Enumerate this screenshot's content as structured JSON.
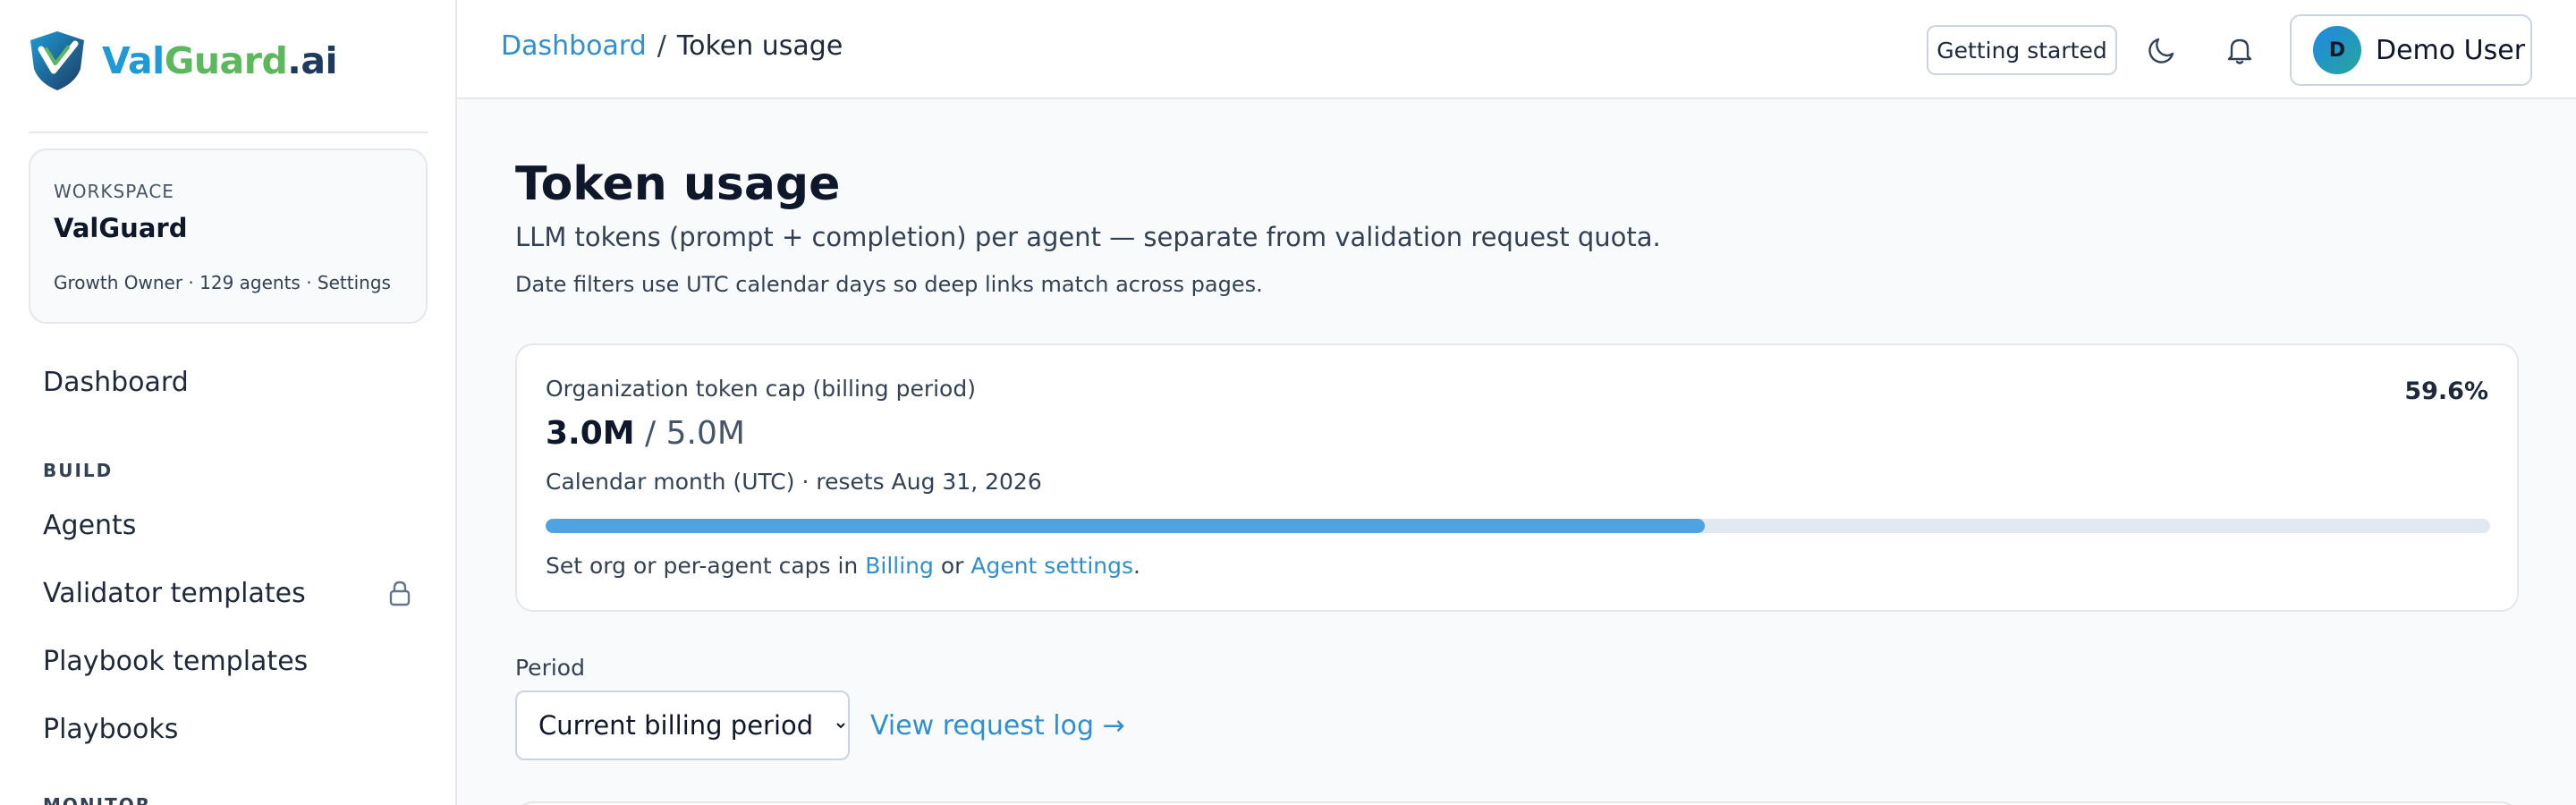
{
  "brand": {
    "part1": "Val",
    "part2": "Guard",
    "part3": ".ai",
    "colors": {
      "primary": "#1e9bd7",
      "accent": "#5cb85c",
      "dark": "#1e3a5f"
    }
  },
  "workspace": {
    "kicker": "WORKSPACE",
    "name": "ValGuard",
    "meta": "Growth Owner · 129 agents · Settings"
  },
  "sidebar": {
    "dashboard": "Dashboard",
    "build_section": "BUILD",
    "items": [
      {
        "label": "Agents"
      },
      {
        "label": "Validator templates",
        "locked": true,
        "icon": "lock-icon"
      },
      {
        "label": "Playbook templates"
      },
      {
        "label": "Playbooks"
      }
    ],
    "next_section": "MONITOR"
  },
  "topbar": {
    "breadcrumb_root": "Dashboard",
    "breadcrumb_sep": "/",
    "breadcrumb_current": "Token usage",
    "getting_started": "Getting started",
    "theme_icon": "moon-icon",
    "notifications_icon": "bell-icon",
    "user": {
      "initial": "D",
      "name": "Demo User"
    }
  },
  "page": {
    "title": "Token usage",
    "subtitle": "LLM tokens (prompt + completion) per agent — separate from validation request quota.",
    "note": "Date filters use UTC calendar days so deep links match across pages."
  },
  "cap": {
    "label": "Organization token cap (billing period)",
    "used": "3.0M",
    "sep": " / ",
    "total": "5.0M",
    "reset": "Calendar month (UTC) · resets Aug 31, 2026",
    "percent": "59.6%",
    "percent_value": 0.596,
    "footer_pre": "Set org or per-agent caps in ",
    "billing_link": "Billing",
    "footer_or": " or ",
    "agent_settings_link": "Agent settings",
    "footer_end": "."
  },
  "period": {
    "label": "Period",
    "selected": "Current billing period",
    "request_log": "View request log →"
  }
}
